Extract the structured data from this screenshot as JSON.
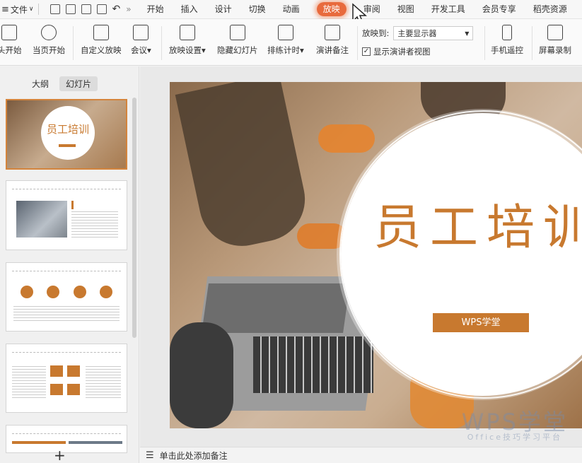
{
  "menubar": {
    "file_label": "文件",
    "tabs": [
      "开始",
      "插入",
      "设计",
      "切换",
      "动画",
      "放映",
      "审阅",
      "视图",
      "开发工具",
      "会员专享",
      "稻壳资源"
    ],
    "active_tab": "放映"
  },
  "ribbon": {
    "from_start": "头开始",
    "from_current": "当页开始",
    "custom_show": "自定义放映",
    "meeting": "会议",
    "show_settings": "放映设置",
    "hide_slide": "隐藏幻灯片",
    "rehearse": "排练计时",
    "speaker_notes": "演讲备注",
    "play_to_label": "放映到:",
    "play_to_value": "主要显示器",
    "presenter_view": "显示演讲者视图",
    "phone_remote": "手机遥控",
    "screen_record": "屏幕录制"
  },
  "panel": {
    "tab_outline": "大纲",
    "tab_slides": "幻灯片",
    "thumb1_title": "员工培训"
  },
  "slide": {
    "title": "员工培训",
    "badge": "WPS学堂"
  },
  "notes": {
    "placeholder": "单击此处添加备注"
  },
  "watermark": {
    "main": "WPS学堂",
    "sub": "Office技巧学习平台"
  }
}
